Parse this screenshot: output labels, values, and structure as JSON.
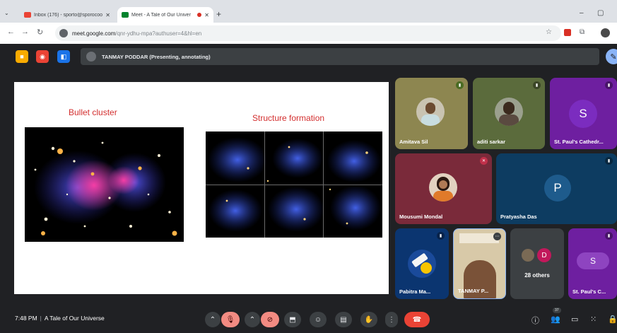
{
  "browser": {
    "tabs": [
      {
        "title": "Inbox (176) - sporto@sporocoo",
        "close": "✕"
      },
      {
        "title": "Meet - A Tale of Our Univer",
        "close": "✕"
      }
    ],
    "new_tab": "+",
    "url_main": "meet.google.com",
    "url_rest": "/qnr-ydhu-mpa?authuser=4&hl=en"
  },
  "meet": {
    "presenter_banner": "TANMAY PODDAR (Presenting, annotating)",
    "slide": {
      "left_title": "Bullet cluster",
      "right_title": "Structure formation"
    },
    "participants": [
      {
        "name": "Amitava Sil"
      },
      {
        "name": "aditi sarkar"
      },
      {
        "name": "St. Paul's Cathedr...",
        "initial": "S"
      },
      {
        "name": "Mousumi Mondal"
      },
      {
        "name": "Pratyasha Das",
        "initial": "P"
      },
      {
        "name": "Pabitra Ma..."
      },
      {
        "name": "TANMAY P..."
      },
      {
        "name": "28 others",
        "initial": "D"
      },
      {
        "name": "St. Paul's C...",
        "initial": "S"
      }
    ],
    "bottom": {
      "time": "7:48 PM",
      "separator": "|",
      "meeting_title": "A Tale of Our Universe",
      "people_count": "37"
    }
  },
  "colors": {
    "meet_bg": "#202124",
    "slide_title_red": "#d32f2f",
    "hangup_red": "#ea4335",
    "mic_off_red": "#f28b82"
  },
  "icons": [
    "chevron-down-icon",
    "gmail-icon",
    "meet-icon",
    "back-icon",
    "forward-icon",
    "reload-icon",
    "star-icon",
    "extension-icon",
    "profile-icon",
    "pen-icon",
    "mic-off-icon",
    "camera-off-icon",
    "present-icon",
    "emoji-icon",
    "captions-icon",
    "raise-hand-icon",
    "more-icon",
    "hangup-icon",
    "info-icon",
    "people-icon",
    "chat-icon",
    "activities-icon",
    "lock-icon"
  ]
}
